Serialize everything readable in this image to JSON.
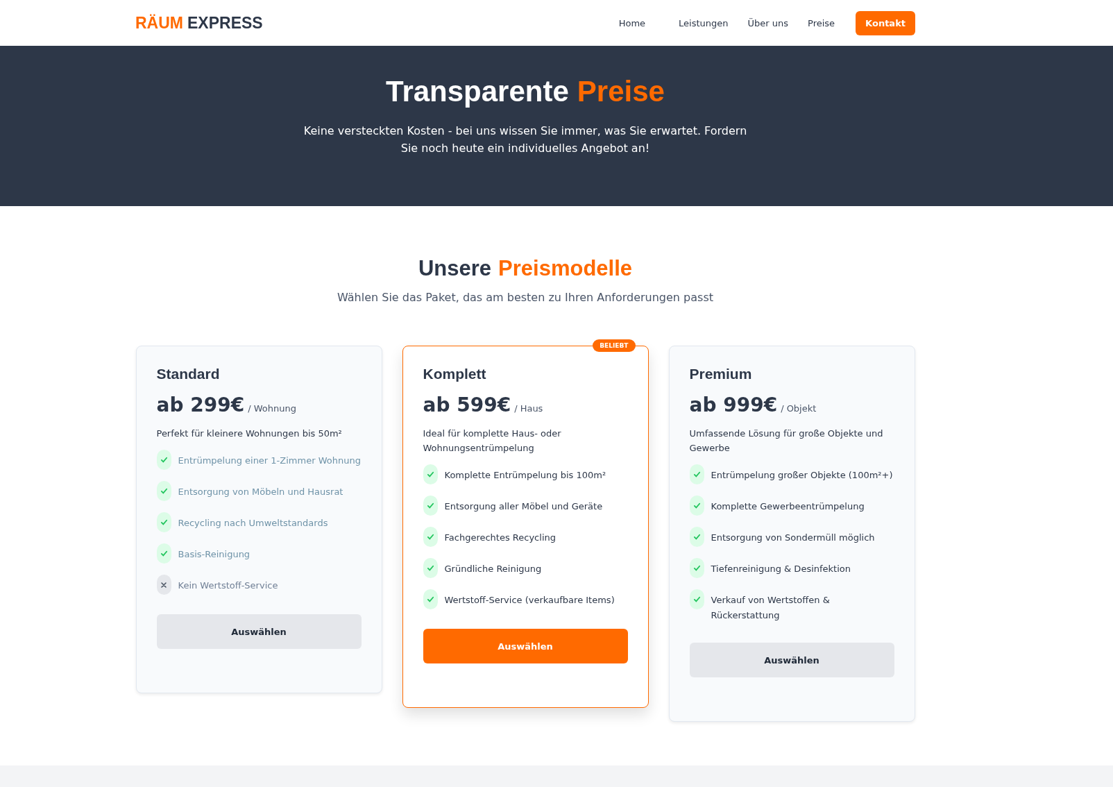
{
  "header": {
    "logo": {
      "accent": "RÄUM",
      "rest": "EXPRESS"
    },
    "nav": [
      {
        "label": "Home",
        "kind": "link"
      },
      {
        "label": "Leistungen",
        "kind": "link"
      },
      {
        "label": "Über uns",
        "kind": "link"
      },
      {
        "label": "Preise",
        "kind": "link"
      },
      {
        "label": "Kontakt",
        "kind": "cta"
      }
    ]
  },
  "hero": {
    "title": "Transparente",
    "title_accent": "Preise",
    "text": "Keine versteckten Kosten - bei uns wissen Sie immer, was Sie erwartet. Fordern Sie noch heute ein individuelles Angebot an!"
  },
  "pricing": {
    "title": "Unsere",
    "title_accent": "Preismodelle",
    "subtitle": "Wählen Sie das Paket, das am besten zu Ihren Anforderungen passt",
    "plans": [
      {
        "name": "Standard",
        "price": "ab 299€",
        "unit": "/ Wohnung",
        "description": "Perfekt für kleinere Wohnungen bis 50m²",
        "highlighted": false,
        "button": "Auswählen",
        "features": [
          {
            "text": "Entrümpelung einer 1-Zimmer Wohnung",
            "included": true,
            "faded": true
          },
          {
            "text": "Entsorgung von Möbeln und Hausrat",
            "included": true,
            "faded": true
          },
          {
            "text": "Recycling nach Umweltstandards",
            "included": true,
            "faded": true
          },
          {
            "text": "Basis-Reinigung",
            "included": true,
            "faded": true
          },
          {
            "text": "Kein Wertstoff-Service",
            "included": false,
            "faded": false
          }
        ]
      },
      {
        "name": "Komplett",
        "price": "ab 599€",
        "unit": "/ Haus",
        "description": "Ideal für komplette Haus- oder Wohnungsentrümpelung",
        "highlighted": true,
        "badge": "BELIEBT",
        "button": "Auswählen",
        "features": [
          {
            "text": "Komplette Entrümpelung bis 100m²",
            "included": true,
            "faded": false
          },
          {
            "text": "Entsorgung aller Möbel und Geräte",
            "included": true,
            "faded": false
          },
          {
            "text": "Fachgerechtes Recycling",
            "included": true,
            "faded": false
          },
          {
            "text": "Gründliche Reinigung",
            "included": true,
            "faded": false
          },
          {
            "text": "Wertstoff-Service (verkaufbare Items)",
            "included": true,
            "faded": false
          }
        ]
      },
      {
        "name": "Premium",
        "price": "ab 999€",
        "unit": "/ Objekt",
        "description": "Umfassende Lösung für große Objekte und Gewerbe",
        "highlighted": false,
        "button": "Auswählen",
        "features": [
          {
            "text": "Entrümpelung großer Objekte (100m²+)",
            "included": true,
            "faded": false
          },
          {
            "text": "Komplette Gewerbeentrümpelung",
            "included": true,
            "faded": false
          },
          {
            "text": "Entsorgung von Sondermüll möglich",
            "included": true,
            "faded": false
          },
          {
            "text": "Tiefenreinigung & Desinfektion",
            "included": true,
            "faded": false
          },
          {
            "text": "Verkauf von Wertstoffen & Rückerstattung",
            "included": true,
            "faded": false
          }
        ]
      }
    ]
  }
}
